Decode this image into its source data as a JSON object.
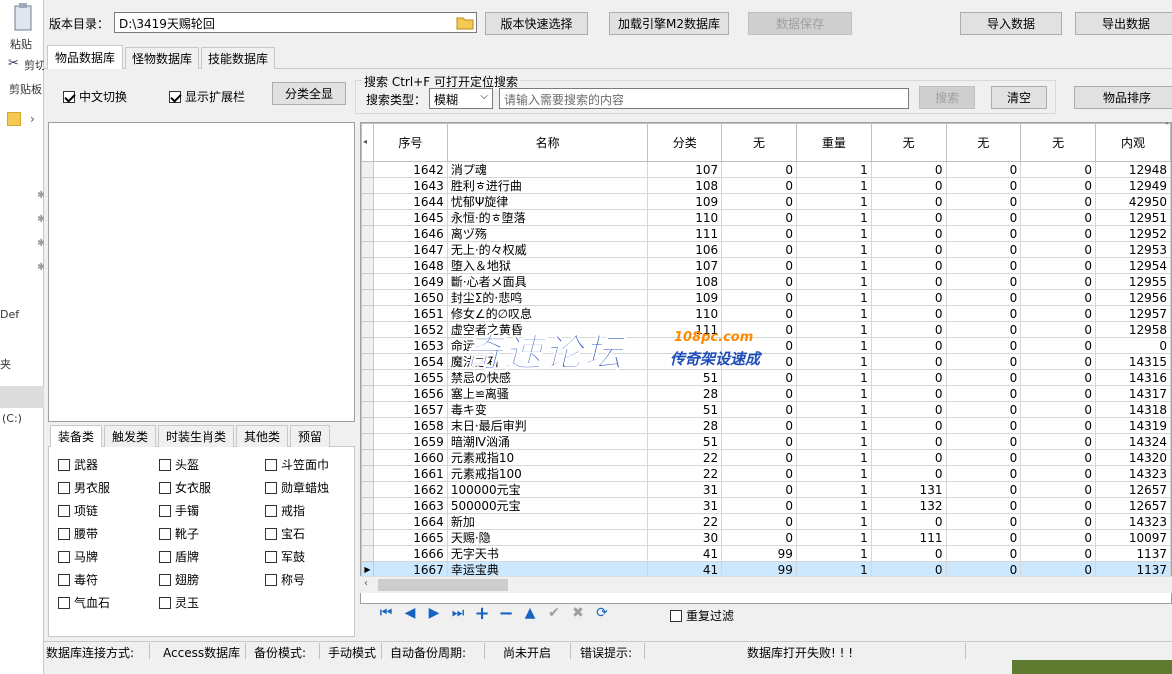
{
  "background_app": {
    "paste_label": "粘贴",
    "cut_label": "剪切",
    "clipboard_label": "剪贴板",
    "def_label": "Def",
    "jia_label": "夹",
    "drive_label": "(C:)"
  },
  "toolbar": {
    "version_dir_label": "版本目录：",
    "version_dir_value": "D:\\3419天赐轮回",
    "quick_select": "版本快速选择",
    "load_engine": "加载引擎M2数据库",
    "save_data": "数据保存",
    "import_data": "导入数据",
    "export_data": "导出数据"
  },
  "tabs": [
    "物品数据库",
    "怪物数据库",
    "技能数据库"
  ],
  "options": {
    "chinese_switch": "中文切换",
    "show_extend": "显示扩展栏",
    "show_all_categories": "分类全显"
  },
  "search": {
    "group_title": "搜索  Ctrl+F 可打开定位搜索",
    "type_label": "搜索类型：",
    "type_value": "模糊",
    "placeholder": "请输入需要搜索的内容",
    "search_button": "搜索",
    "clear_button": "清空",
    "sort_button": "物品排序"
  },
  "category_tabs": [
    "装备类",
    "触发类",
    "时装生肖类",
    "其他类",
    "预留"
  ],
  "equipment_checkboxes": [
    [
      "武器",
      "头盔",
      "斗笠面巾"
    ],
    [
      "男衣服",
      "女衣服",
      "勋章蜡烛"
    ],
    [
      "项链",
      "手镯",
      "戒指"
    ],
    [
      "腰带",
      "靴子",
      "宝石"
    ],
    [
      "马牌",
      "盾牌",
      "军鼓"
    ],
    [
      "毒符",
      "翅膀",
      "称号"
    ],
    [
      "气血石",
      "灵玉",
      ""
    ]
  ],
  "grid": {
    "columns": [
      "序号",
      "名称",
      "分类",
      "无",
      "重量",
      "无",
      "无",
      "无",
      "内观"
    ],
    "rows": [
      [
        "1642",
        "消プ魂",
        "107",
        "0",
        "1",
        "0",
        "0",
        "0",
        "12948"
      ],
      [
        "1643",
        "胜利ㅎ进行曲",
        "108",
        "0",
        "1",
        "0",
        "0",
        "0",
        "12949"
      ],
      [
        "1644",
        "忧郁Ψ旋律",
        "109",
        "0",
        "1",
        "0",
        "0",
        "0",
        "42950"
      ],
      [
        "1645",
        "永恒·的ㅎ堕落",
        "110",
        "0",
        "1",
        "0",
        "0",
        "0",
        "12951"
      ],
      [
        "1646",
        "离ヅ殇",
        "111",
        "0",
        "1",
        "0",
        "0",
        "0",
        "12952"
      ],
      [
        "1647",
        "无上·的々权威",
        "106",
        "0",
        "1",
        "0",
        "0",
        "0",
        "12953"
      ],
      [
        "1648",
        "堕入＆地狱",
        "107",
        "0",
        "1",
        "0",
        "0",
        "0",
        "12954"
      ],
      [
        "1649",
        "斷·心者メ面具",
        "108",
        "0",
        "1",
        "0",
        "0",
        "0",
        "12955"
      ],
      [
        "1650",
        "封尘Σ的·悲鸣",
        "109",
        "0",
        "1",
        "0",
        "0",
        "0",
        "12956"
      ],
      [
        "1651",
        "修女∠的∅叹息",
        "110",
        "0",
        "1",
        "0",
        "0",
        "0",
        "12957"
      ],
      [
        "1652",
        "虚空者之黄昏",
        "111",
        "0",
        "1",
        "0",
        "0",
        "0",
        "12958"
      ],
      [
        "1653",
        "命运",
        "",
        "0",
        "1",
        "0",
        "0",
        "0",
        "0"
      ],
      [
        "1654",
        "魔法之石",
        "",
        "0",
        "1",
        "0",
        "0",
        "0",
        "14315"
      ],
      [
        "1655",
        "禁忌の快感",
        "51",
        "0",
        "1",
        "0",
        "0",
        "0",
        "14316"
      ],
      [
        "1656",
        "塞上≌离骚",
        "28",
        "0",
        "1",
        "0",
        "0",
        "0",
        "14317"
      ],
      [
        "1657",
        "毒キ变",
        "51",
        "0",
        "1",
        "0",
        "0",
        "0",
        "14318"
      ],
      [
        "1658",
        "末日·最后审判",
        "28",
        "0",
        "1",
        "0",
        "0",
        "0",
        "14319"
      ],
      [
        "1659",
        "暗潮Ⅳ汹涌",
        "51",
        "0",
        "1",
        "0",
        "0",
        "0",
        "14324"
      ],
      [
        "1660",
        "元素戒指10",
        "22",
        "0",
        "1",
        "0",
        "0",
        "0",
        "14320"
      ],
      [
        "1661",
        "元素戒指100",
        "22",
        "0",
        "1",
        "0",
        "0",
        "0",
        "14323"
      ],
      [
        "1662",
        "100000元宝",
        "31",
        "0",
        "1",
        "131",
        "0",
        "0",
        "12657"
      ],
      [
        "1663",
        "500000元宝",
        "31",
        "0",
        "1",
        "132",
        "0",
        "0",
        "12657"
      ],
      [
        "1664",
        "新加",
        "22",
        "0",
        "1",
        "0",
        "0",
        "0",
        "14323"
      ],
      [
        "1665",
        "天赐·隐",
        "30",
        "0",
        "1",
        "111",
        "0",
        "0",
        "10097"
      ],
      [
        "1666",
        "无字天书",
        "41",
        "99",
        "1",
        "0",
        "0",
        "0",
        "1137"
      ],
      [
        "1667",
        "幸运宝典",
        "41",
        "99",
        "1",
        "0",
        "0",
        "0",
        "1137"
      ]
    ]
  },
  "bottom": {
    "repeat_filter": "重复过滤"
  },
  "status": {
    "conn_label": "数据库连接方式:",
    "conn_value": "Access数据库",
    "backup_label": "备份模式:",
    "backup_value": "手动模式",
    "auto_label": "自动备份周期:",
    "auto_value": "尚未开启",
    "error_label": "错误提示:",
    "error_value": "数据库打开失败! ! !"
  },
  "watermark": {
    "main": "奇速论坛",
    "url": "108pc.com",
    "sub": "传奇架设速成"
  }
}
